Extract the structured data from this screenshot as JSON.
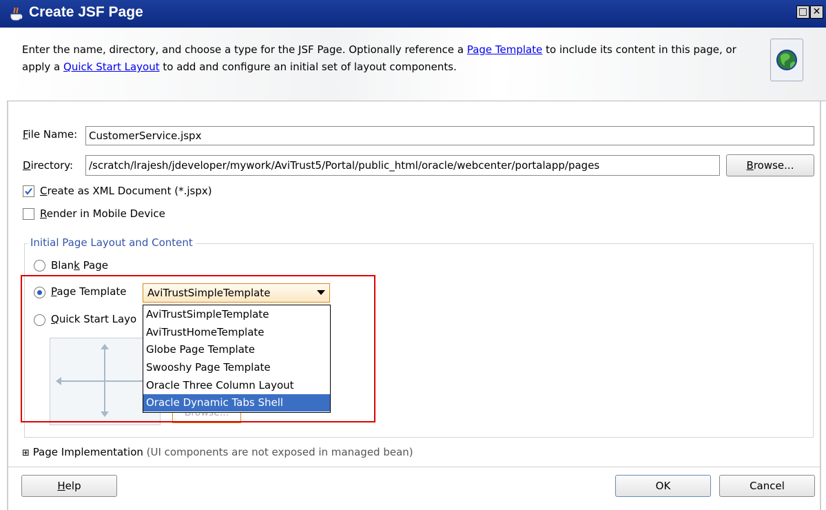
{
  "window": {
    "title": "Create JSF Page",
    "restore_label": "□",
    "close_label": "✕"
  },
  "header": {
    "desc_part1": "Enter the name, directory, and choose a type for the JSF Page. Optionally reference a ",
    "link_page_template": "Page Template",
    "desc_part2": " to include its content in this page, or apply a ",
    "link_quick_start": "Quick Start Layout",
    "desc_part3": " to add and configure an initial set of layout components.",
    "icon": "globe-icon"
  },
  "form": {
    "file_name_label_rest": "ile Name:",
    "file_name_value": "CustomerService.jspx",
    "directory_label_rest": "irectory:",
    "directory_value": "/scratch/lrajesh/jdeveloper/mywork/AviTrust5/Portal/public_html/oracle/webcenter/portalapp/pages",
    "browse_rest": "rowse...",
    "create_xml_rest": "reate as XML Document (*.jspx)",
    "create_xml_checked": true,
    "render_mobile_rest": "ender in Mobile Device",
    "render_mobile_checked": false
  },
  "layout_group": {
    "title": "Initial Page Layout and Content",
    "blank_a": "Blan",
    "blank_b": " Page",
    "page_template_rest": "age Template",
    "quick_start_rest": "uick Start Layo",
    "selected_template": "AviTrustSimpleTemplate",
    "template_options": [
      "AviTrustSimpleTemplate",
      "AviTrustHomeTemplate",
      "Globe Page Template",
      "Swooshy Page Template",
      "Oracle Three Column Layout",
      "Oracle Dynamic Tabs Shell"
    ],
    "highlighted_option": "Oracle Dynamic Tabs Shell",
    "hidden_browse": "Browse..."
  },
  "implementation": {
    "expander": "⊞",
    "title": "Page Implementation",
    "note": " (UI components are not exposed in managed bean)"
  },
  "footer": {
    "help_rest": "elp",
    "ok": "OK",
    "cancel": "Cancel"
  }
}
